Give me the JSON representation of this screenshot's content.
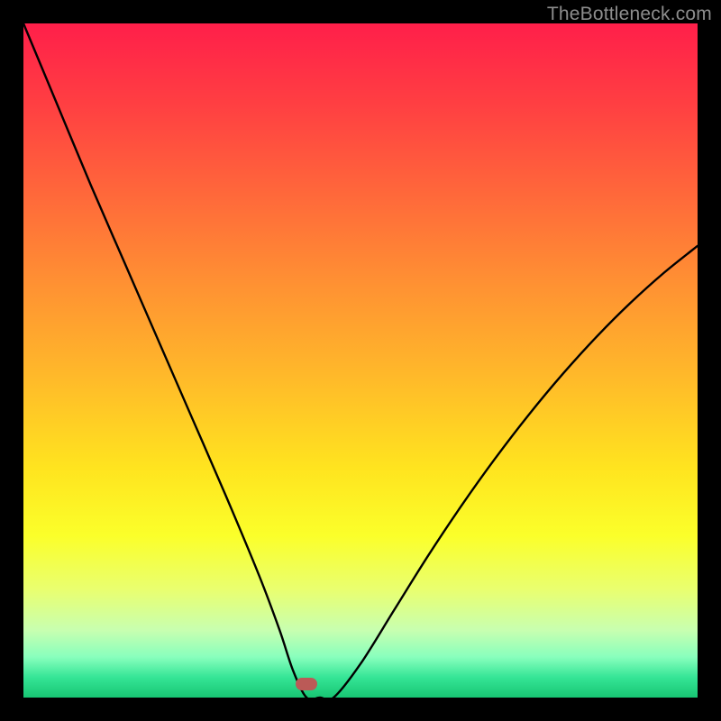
{
  "watermark": "TheBottleneck.com",
  "colors": {
    "frame": "#000000",
    "watermark": "#8d8d8d",
    "curve": "#000000",
    "marker": "#bb5a57",
    "gradient_top": "#ff1f4a",
    "gradient_bottom": "#18c673"
  },
  "chart_data": {
    "type": "line",
    "title": "",
    "xlabel": "",
    "ylabel": "",
    "xlim": [
      0,
      100
    ],
    "ylim": [
      0,
      100
    ],
    "grid": false,
    "legend": false,
    "series": [
      {
        "name": "bottleneck-curve",
        "x": [
          0,
          5,
          10,
          15,
          20,
          25,
          30,
          35,
          38,
          40,
          42,
          44,
          46,
          50,
          55,
          60,
          65,
          70,
          75,
          80,
          85,
          90,
          95,
          100
        ],
        "values": [
          100,
          88,
          76,
          64.5,
          53,
          41.5,
          30,
          18,
          10,
          4,
          0,
          0,
          0,
          5,
          13,
          21,
          28.5,
          35.5,
          42,
          48,
          53.5,
          58.5,
          63,
          67
        ]
      }
    ],
    "annotations": [
      {
        "name": "optimal-marker",
        "x": 42,
        "y": 2
      }
    ]
  }
}
